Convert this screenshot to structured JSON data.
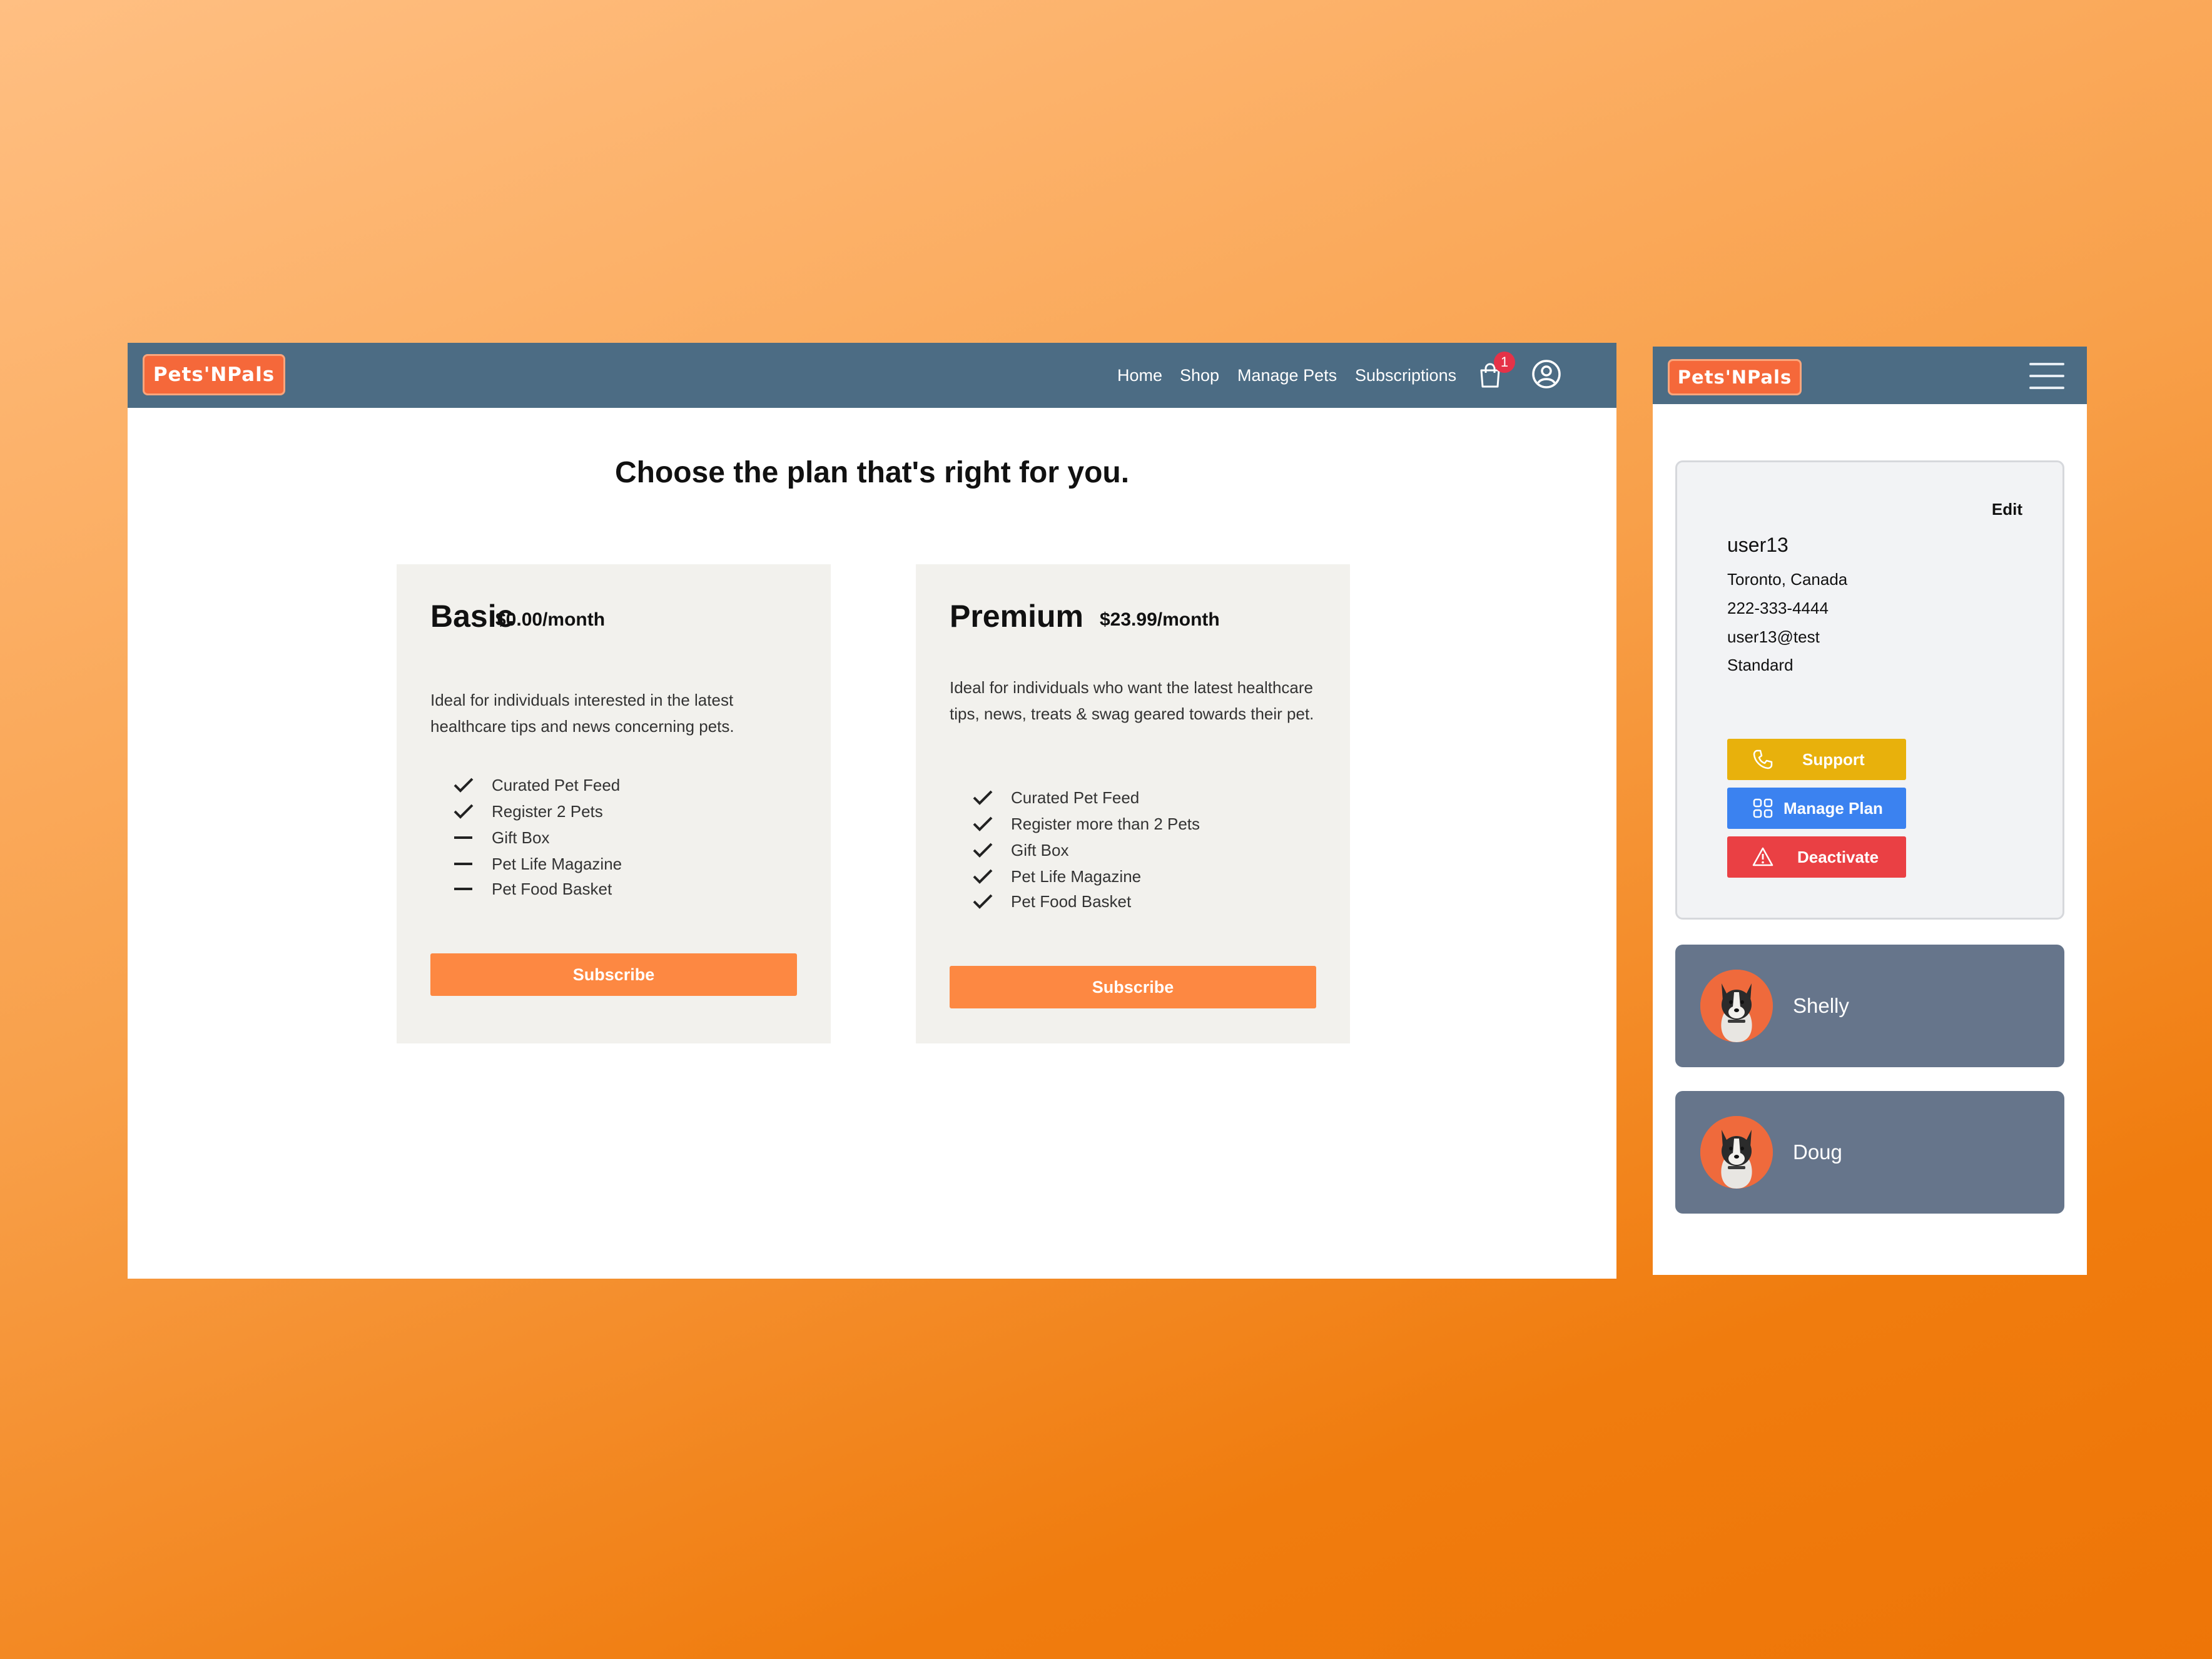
{
  "brand": {
    "logo_text": "Pets'NPals"
  },
  "desktop": {
    "nav": {
      "links": [
        "Home",
        "Shop",
        "Manage Pets",
        "Subscriptions"
      ],
      "cart_count": "1"
    },
    "title": "Choose the plan that's right for you.",
    "plans": [
      {
        "name": "Basic",
        "price": "$0.00/month",
        "description": "Ideal for individuals interested in the latest healthcare tips and news concerning pets.",
        "features": [
          {
            "label": "Curated Pet Feed",
            "included": true
          },
          {
            "label": "Register 2 Pets",
            "included": true
          },
          {
            "label": "Gift Box",
            "included": false
          },
          {
            "label": "Pet Life Magazine",
            "included": false
          },
          {
            "label": "Pet Food Basket",
            "included": false
          }
        ],
        "button": "Subscribe"
      },
      {
        "name": "Premium",
        "price": "$23.99/month",
        "description": "Ideal for individuals who want the latest healthcare tips, news, treats & swag geared towards their pet.",
        "features": [
          {
            "label": "Curated Pet Feed",
            "included": true
          },
          {
            "label": "Register more than 2 Pets",
            "included": true
          },
          {
            "label": "Gift Box",
            "included": true
          },
          {
            "label": "Pet Life Magazine",
            "included": true
          },
          {
            "label": "Pet Food Basket",
            "included": true
          }
        ],
        "button": "Subscribe"
      }
    ]
  },
  "mobile": {
    "profile": {
      "edit_label": "Edit",
      "username": "user13",
      "location": "Toronto, Canada",
      "phone": "222-333-4444",
      "email": "user13@test",
      "plan": "Standard",
      "buttons": {
        "support": "Support",
        "manage": "Manage Plan",
        "deactivate": "Deactivate"
      }
    },
    "pets": [
      {
        "name": "Shelly"
      },
      {
        "name": "Doug"
      }
    ]
  },
  "colors": {
    "nav": "#4c6c84",
    "logo": "#f5683a",
    "subscribe": "#fd8842",
    "support": "#e8b10c",
    "manage": "#3b82f0",
    "deactivate": "#ea4044",
    "pet_card": "#66758b",
    "cart_badge": "#e53248"
  },
  "icons": [
    "cart-icon",
    "user-circle-icon",
    "check-icon",
    "dash-icon",
    "hamburger-icon",
    "phone-icon",
    "grid-icon",
    "warning-icon",
    "dog-avatar-icon"
  ]
}
